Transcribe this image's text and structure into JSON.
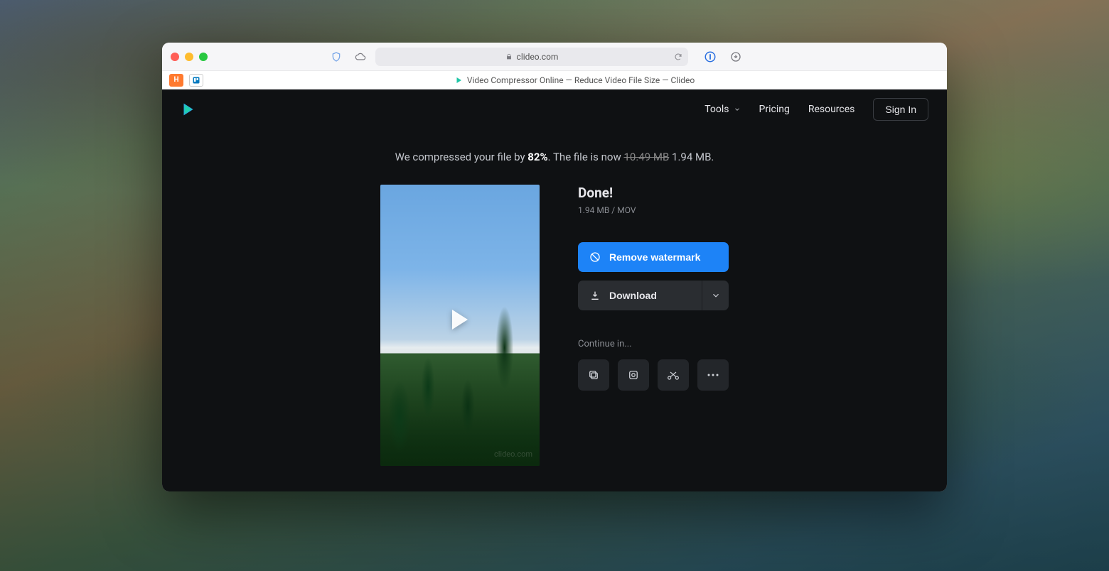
{
  "browser": {
    "address": "clideo.com",
    "tab_title": "Video Compressor Online — Reduce Video File Size — Clideo",
    "mini_tab_h": "H"
  },
  "nav": {
    "tools": "Tools",
    "pricing": "Pricing",
    "resources": "Resources",
    "sign_in": "Sign In"
  },
  "message": {
    "prefix": "We compressed your file by ",
    "percent": "82%",
    "mid": ". The file is now ",
    "old_size": "10.49 MB",
    "new_size": " 1.94 MB."
  },
  "result": {
    "heading": "Done!",
    "size": "1.94 MB",
    "sep": "  /  ",
    "format": "MOV",
    "watermark_text": "clideo.com"
  },
  "actions": {
    "remove_watermark": "Remove watermark",
    "download": "Download",
    "continue_label": "Continue in..."
  }
}
